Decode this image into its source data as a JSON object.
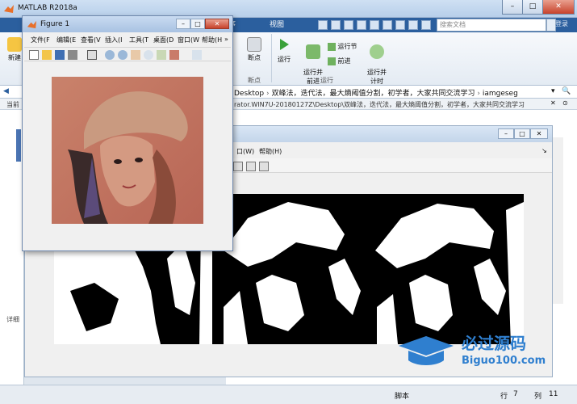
{
  "app": {
    "title": "MATLAB R2018a"
  },
  "tabs": {
    "apps": "应用程序",
    "view": "视图"
  },
  "search": {
    "placeholder": "搜索文档"
  },
  "community": "登录",
  "ribbon": {
    "new_label": "新建",
    "breakpoints_label": "断点",
    "run_label": "运行",
    "run_advance_label": "运行并\n前进",
    "run_section_label": "运行节",
    "advance_label": "前进",
    "run_time_label": "运行并\n计时",
    "group_breakpoints": "断点",
    "group_run": "运行"
  },
  "address": {
    "segments": [
      "Desktop",
      "双峰法，迭代法，最大熵阈值分割，初学者，大家共同交流学习",
      "iamgeseg"
    ],
    "cwd_label": "当前",
    "cwd_path": "rator.WIN7U-20180127Z\\Desktop\\双峰法，迭代法，最大熵阈值分割，初学者，大家共同交流学习"
  },
  "left": {
    "details_label": "详细"
  },
  "figure1": {
    "title": "Figure 1",
    "menus": [
      "文件(F",
      "编辑(E",
      "查看(V",
      "插入(I",
      "工具(T",
      "桌面(D",
      "窗口(W",
      "帮助(H"
    ]
  },
  "figure2": {
    "menus": [
      "口(W)",
      "帮助(H)"
    ]
  },
  "status": {
    "script": "脚本",
    "row_label": "行",
    "row": "7",
    "col_label": "列",
    "col": "11"
  },
  "watermark": {
    "cn": "必过源码",
    "en": "Biguo100.com"
  },
  "colors": {
    "ribbon_tab": "#2b5f9e",
    "watermark": "#2f7fcf"
  }
}
